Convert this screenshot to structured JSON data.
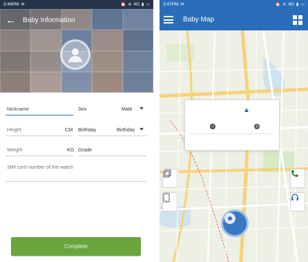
{
  "left_screen": {
    "status_bar": {
      "time": "3:46PM",
      "network": "4G"
    },
    "header": {
      "title": "Baby Information",
      "back_icon": "arrow-left-icon",
      "avatar_icon": "camera-avatar-icon"
    },
    "form": {
      "nickname": {
        "placeholder": "Nickname",
        "value": ""
      },
      "sex": {
        "label": "Sex",
        "value": "Male"
      },
      "height": {
        "placeholder": "Height",
        "unit": "CM"
      },
      "birthday": {
        "label": "Birthday",
        "value": "Birthday"
      },
      "weight": {
        "placeholder": "Weight",
        "unit": "KG"
      },
      "grade": {
        "label": "Grade",
        "value": ""
      },
      "sim": {
        "placeholder": "SIM card number of the watch",
        "value": ""
      }
    },
    "complete_label": "Complete",
    "colors": {
      "accent": "#2a6db8",
      "complete_button": "#6aa53e"
    }
  },
  "right_screen": {
    "status_bar": {
      "time": "3:47PM",
      "network": "4G"
    },
    "app_bar": {
      "title": "Baby Map",
      "menu_icon": "hamburger-menu-icon",
      "grid_icon": "grid-view-icon"
    },
    "info_card": {
      "time_icon": "clock-icon",
      "location_icon": "gps-icon",
      "navigate_icon": "navigation-arrow-icon"
    },
    "side_buttons": [
      "square-frame-icon",
      "phone-outline-icon",
      "phone-call-icon",
      "headphones-icon"
    ],
    "locate_icon": "locate-me-icon",
    "colors": {
      "appbar": "#2a6db8",
      "map_background": "#eef0e6",
      "road_major": "#f6d27a",
      "pin": "#6bb35a"
    }
  }
}
